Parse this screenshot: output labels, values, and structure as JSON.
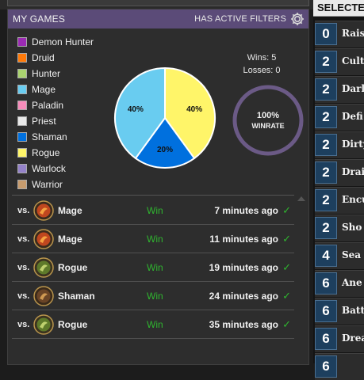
{
  "panel": {
    "title": "MY GAMES",
    "filter_label": "HAS ACTIVE FILTERS",
    "header_color": "#5b4b78"
  },
  "legend": [
    {
      "label": "Demon Hunter",
      "color": "#9b2bb3"
    },
    {
      "label": "Druid",
      "color": "#ff7a0a"
    },
    {
      "label": "Hunter",
      "color": "#a9d26f"
    },
    {
      "label": "Mage",
      "color": "#69ccf0"
    },
    {
      "label": "Paladin",
      "color": "#f58cba"
    },
    {
      "label": "Priest",
      "color": "#e8e8e8"
    },
    {
      "label": "Shaman",
      "color": "#0070de"
    },
    {
      "label": "Rogue",
      "color": "#fff569"
    },
    {
      "label": "Warlock",
      "color": "#9482c9"
    },
    {
      "label": "Warrior",
      "color": "#c79c6e"
    }
  ],
  "chart_data": {
    "type": "pie",
    "slices": [
      {
        "class": "Rogue",
        "value": 40,
        "label": "40%",
        "color": "#fff569"
      },
      {
        "class": "Shaman",
        "value": 20,
        "label": "20%",
        "color": "#0070de"
      },
      {
        "class": "Mage",
        "value": 40,
        "label": "40%",
        "color": "#69ccf0"
      }
    ]
  },
  "stats": {
    "wins_text": "Wins: 5",
    "losses_text": "Losses: 0",
    "winrate_value": "100%",
    "winrate_label": "WINRATE",
    "winrate_fraction": 1.0,
    "ring_color": "#6b5a86"
  },
  "games": [
    {
      "vs": "vs.",
      "opponent": "Mage",
      "icon": "mage-hero-icon",
      "result": "Win",
      "time": "7 minutes ago",
      "check": "✓"
    },
    {
      "vs": "vs.",
      "opponent": "Mage",
      "icon": "mage-hero-icon",
      "result": "Win",
      "time": "11 minutes ago",
      "check": "✓"
    },
    {
      "vs": "vs.",
      "opponent": "Rogue",
      "icon": "rogue-hero-icon",
      "result": "Win",
      "time": "19 minutes ago",
      "check": "✓"
    },
    {
      "vs": "vs.",
      "opponent": "Shaman",
      "icon": "shaman-hero-icon",
      "result": "Win",
      "time": "24 minutes ago",
      "check": "✓"
    },
    {
      "vs": "vs.",
      "opponent": "Rogue",
      "icon": "rogue-hero-icon",
      "result": "Win",
      "time": "35 minutes ago",
      "check": "✓"
    }
  ],
  "right_panel": {
    "header": "SELECTED",
    "cards": [
      {
        "cost": "0",
        "name": "Rais"
      },
      {
        "cost": "2",
        "name": "Cult"
      },
      {
        "cost": "2",
        "name": "Darl"
      },
      {
        "cost": "2",
        "name": "Defi"
      },
      {
        "cost": "2",
        "name": "Dirty"
      },
      {
        "cost": "2",
        "name": "Drai"
      },
      {
        "cost": "2",
        "name": "Encu"
      },
      {
        "cost": "2",
        "name": "Sho"
      },
      {
        "cost": "4",
        "name": "Sea"
      },
      {
        "cost": "6",
        "name": "Ane"
      },
      {
        "cost": "6",
        "name": "Battl"
      },
      {
        "cost": "6",
        "name": "Drea"
      },
      {
        "cost": "6",
        "name": ""
      }
    ]
  }
}
